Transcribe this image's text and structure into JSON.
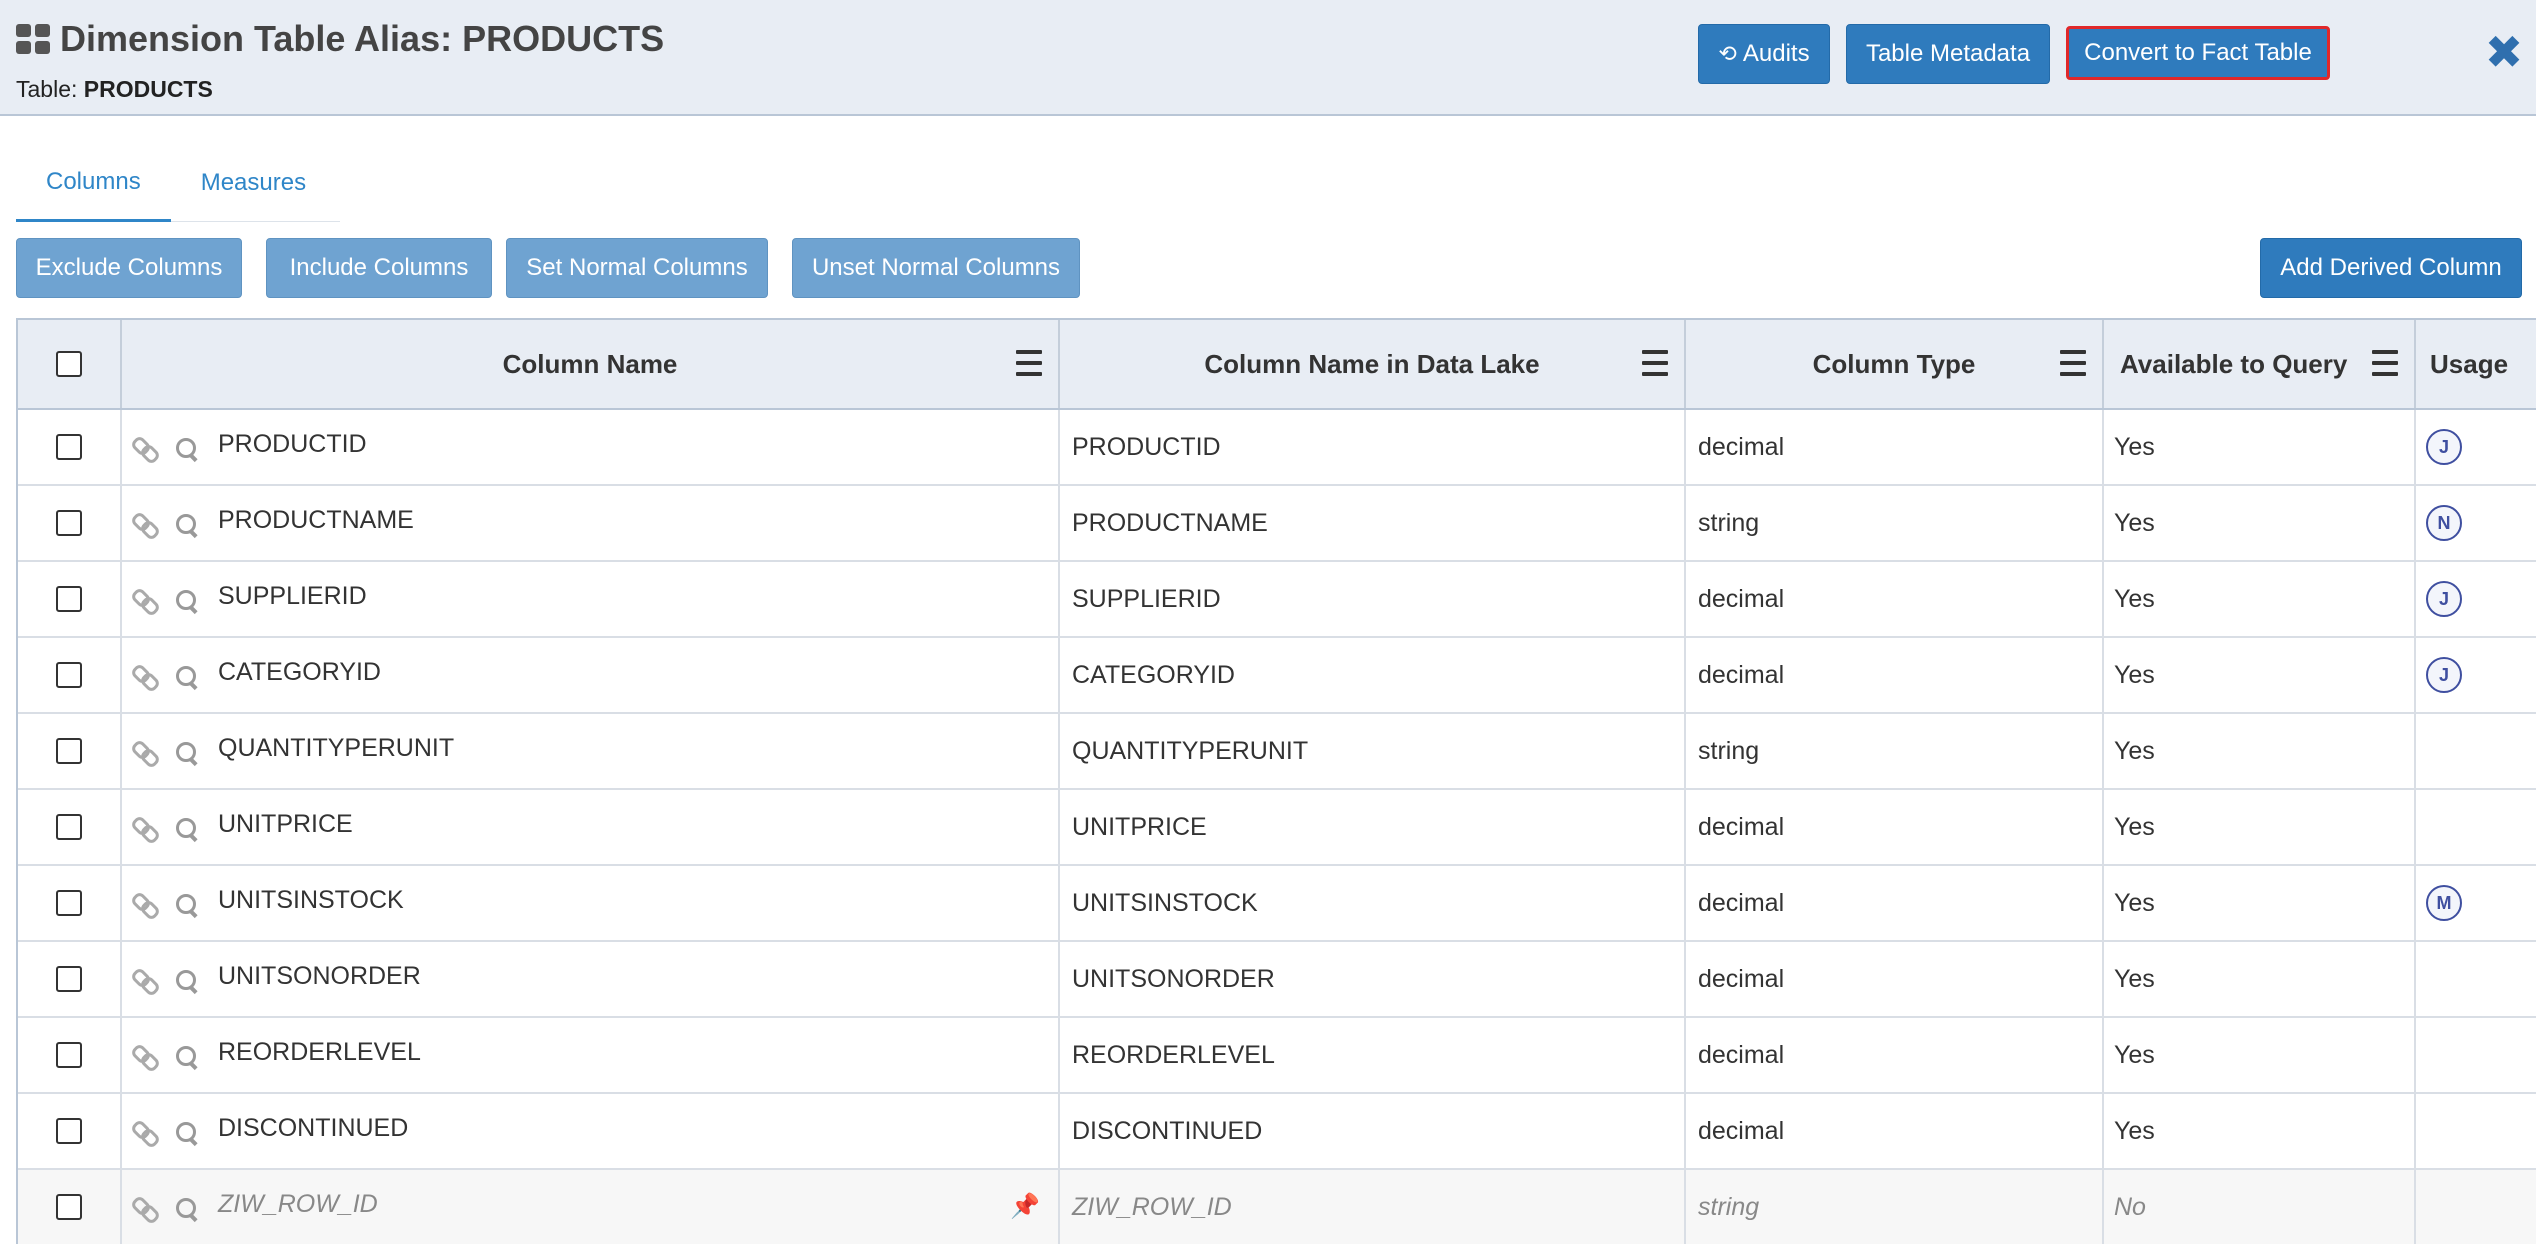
{
  "header": {
    "title": "Dimension Table Alias: PRODUCTS",
    "subtitle_label": "Table:",
    "subtitle_value": "PRODUCTS",
    "audits_label": "Audits",
    "metadata_label": "Table Metadata",
    "convert_label": "Convert to Fact Table",
    "close_glyph": "✖"
  },
  "tabs": [
    {
      "label": "Columns",
      "active": true
    },
    {
      "label": "Measures",
      "active": false
    }
  ],
  "toolbar": {
    "exclude": "Exclude Columns",
    "include": "Include Columns",
    "set_normal": "Set Normal Columns",
    "unset_normal": "Unset Normal Columns",
    "add_derived": "Add Derived Column"
  },
  "table": {
    "headers": [
      "Column Name",
      "Column Name in Data Lake",
      "Column Type",
      "Available to Query",
      "Usage"
    ],
    "rows": [
      {
        "name": "PRODUCTID",
        "lake": "PRODUCTID",
        "type": "decimal",
        "available": "Yes",
        "usage": "J"
      },
      {
        "name": "PRODUCTNAME",
        "lake": "PRODUCTNAME",
        "type": "string",
        "available": "Yes",
        "usage": "N"
      },
      {
        "name": "SUPPLIERID",
        "lake": "SUPPLIERID",
        "type": "decimal",
        "available": "Yes",
        "usage": "J"
      },
      {
        "name": "CATEGORYID",
        "lake": "CATEGORYID",
        "type": "decimal",
        "available": "Yes",
        "usage": "J"
      },
      {
        "name": "QUANTITYPERUNIT",
        "lake": "QUANTITYPERUNIT",
        "type": "string",
        "available": "Yes",
        "usage": ""
      },
      {
        "name": "UNITPRICE",
        "lake": "UNITPRICE",
        "type": "decimal",
        "available": "Yes",
        "usage": ""
      },
      {
        "name": "UNITSINSTOCK",
        "lake": "UNITSINSTOCK",
        "type": "decimal",
        "available": "Yes",
        "usage": "M"
      },
      {
        "name": "UNITSONORDER",
        "lake": "UNITSONORDER",
        "type": "decimal",
        "available": "Yes",
        "usage": ""
      },
      {
        "name": "REORDERLEVEL",
        "lake": "REORDERLEVEL",
        "type": "decimal",
        "available": "Yes",
        "usage": ""
      },
      {
        "name": "DISCONTINUED",
        "lake": "DISCONTINUED",
        "type": "decimal",
        "available": "Yes",
        "usage": ""
      },
      {
        "name": "ZIW_ROW_ID",
        "lake": "ZIW_ROW_ID",
        "type": "string",
        "available": "No",
        "usage": "",
        "system": true,
        "pinned": true
      }
    ]
  },
  "colors": {
    "primary_button": "#2f7bbd",
    "secondary_button": "#6fa3d1",
    "header_bg": "#e8edf4",
    "highlight_border": "#e0282a",
    "badge": "#3f4fa0"
  }
}
